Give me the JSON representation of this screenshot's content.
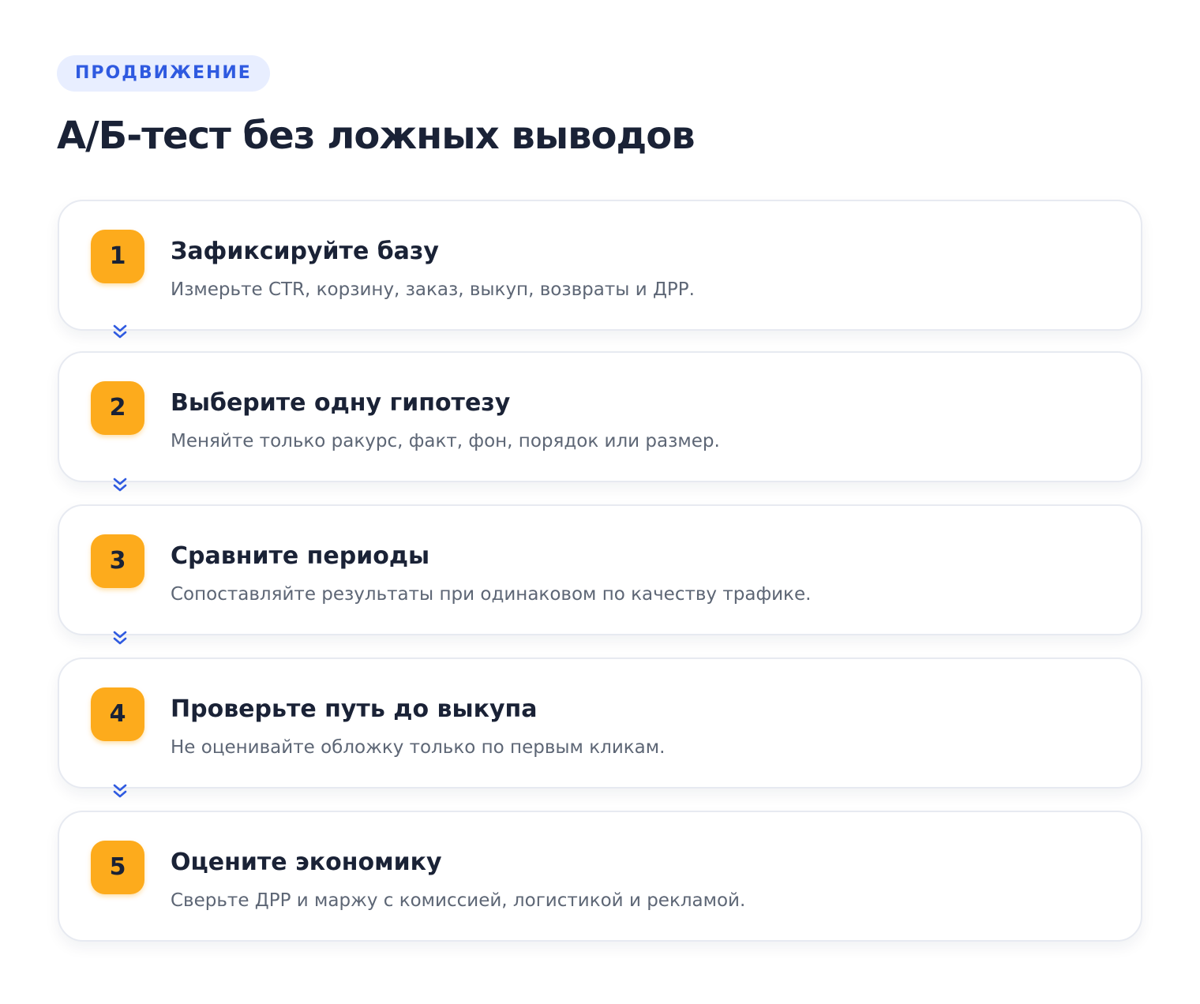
{
  "header": {
    "badge": "ПРОДВИЖЕНИЕ",
    "title": "А/Б-тест без ложных выводов"
  },
  "colors": {
    "badge_bg": "#e8eeff",
    "badge_text": "#2f5ae0",
    "number_bg": "#fdab1c",
    "chevron": "#2f5ae0"
  },
  "icons": {
    "connector": "double-chevron-down-icon"
  },
  "steps": [
    {
      "number": "1",
      "title": "Зафиксируйте базу",
      "description": "Измерьте CTR, корзину, заказ, выкуп, возвраты и ДРР."
    },
    {
      "number": "2",
      "title": "Выберите одну гипотезу",
      "description": "Меняйте только ракурс, факт, фон, порядок или размер."
    },
    {
      "number": "3",
      "title": "Сравните периоды",
      "description": "Сопоставляйте результаты при одинаковом по качеству трафике."
    },
    {
      "number": "4",
      "title": "Проверьте путь до выкупа",
      "description": "Не оценивайте обложку только по первым кликам."
    },
    {
      "number": "5",
      "title": "Оцените экономику",
      "description": "Сверьте ДРР и маржу с комиссией, логистикой и рекламой."
    }
  ]
}
